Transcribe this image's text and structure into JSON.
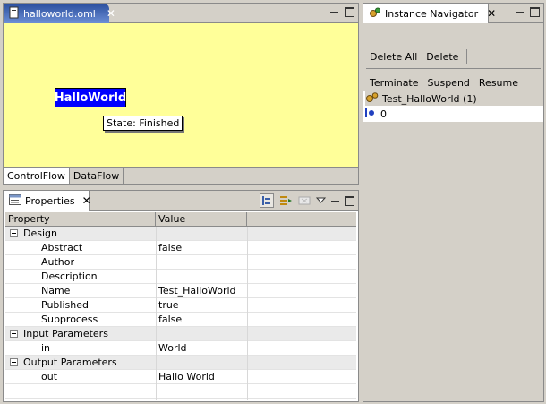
{
  "editor": {
    "tab_title": "halloworld.oml",
    "tab_close": "✕",
    "node_label": "HalloWorld",
    "state_tooltip": "State: Finished",
    "bottom_tabs": [
      "ControlFlow",
      "DataFlow"
    ]
  },
  "properties": {
    "tab_title": "Properties",
    "tab_close": "✕",
    "headers": {
      "property": "Property",
      "value": "Value"
    },
    "rows": [
      {
        "kind": "category",
        "label": "Design"
      },
      {
        "kind": "item",
        "label": "Abstract",
        "value": "false"
      },
      {
        "kind": "item",
        "label": "Author",
        "value": ""
      },
      {
        "kind": "item",
        "label": "Description",
        "value": ""
      },
      {
        "kind": "item",
        "label": "Name",
        "value": "Test_HalloWorld"
      },
      {
        "kind": "item",
        "label": "Published",
        "value": "true"
      },
      {
        "kind": "item",
        "label": "Subprocess",
        "value": "false"
      },
      {
        "kind": "category",
        "label": "Input Parameters"
      },
      {
        "kind": "item",
        "label": "in",
        "value": "World"
      },
      {
        "kind": "category",
        "label": "Output Parameters"
      },
      {
        "kind": "item",
        "label": "out",
        "value": "Hallo World"
      }
    ]
  },
  "navigator": {
    "tab_title": "Instance Navigator",
    "tab_close": "✕",
    "actions1": {
      "delete_all": "Delete All",
      "delete": "Delete"
    },
    "actions2": {
      "terminate": "Terminate",
      "suspend": "Suspend",
      "resume": "Resume"
    },
    "tree": {
      "instance": "Test_HalloWorld (1)",
      "child": "0"
    }
  }
}
